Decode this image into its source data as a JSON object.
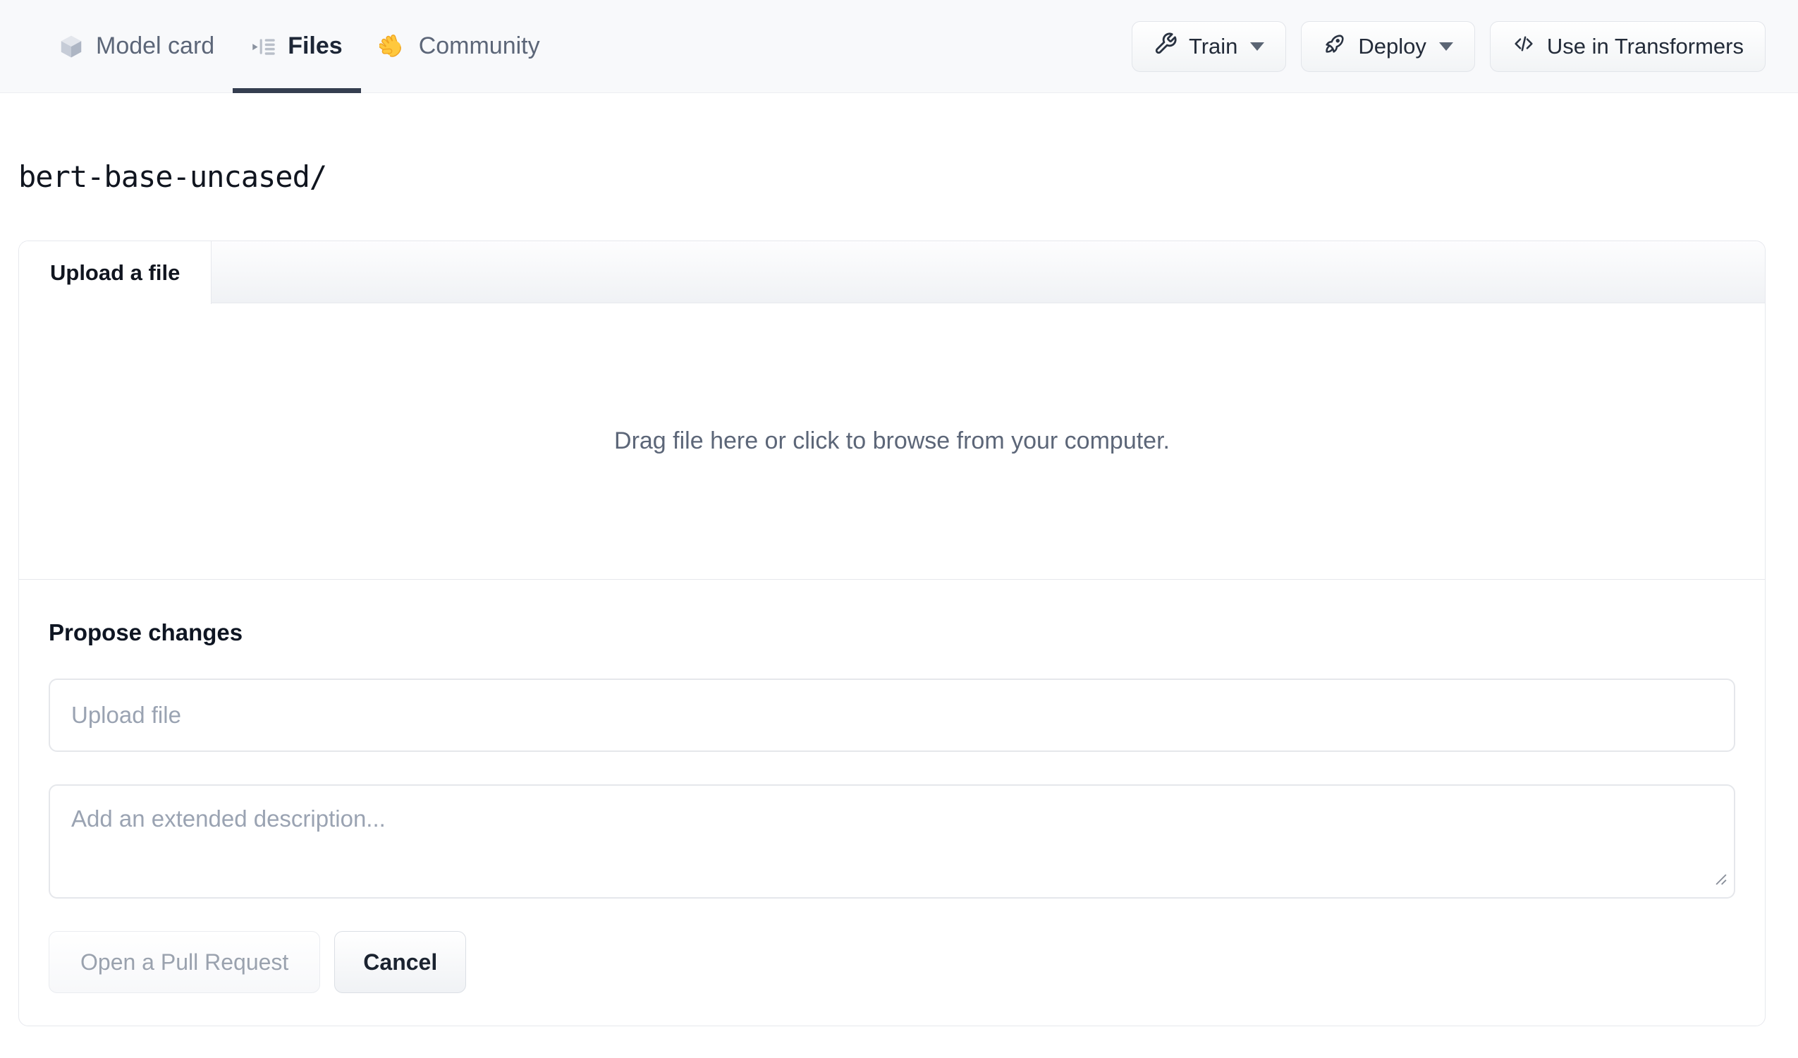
{
  "header": {
    "tabs": [
      {
        "label": "Model card",
        "icon": "cube-icon",
        "active": false
      },
      {
        "label": "Files",
        "icon": "file-versions-icon",
        "active": true
      },
      {
        "label": "Community",
        "icon": "waving-hand-icon",
        "active": false
      }
    ],
    "actions": [
      {
        "label": "Train",
        "icon": "wrench-icon",
        "has_dropdown": true
      },
      {
        "label": "Deploy",
        "icon": "rocket-icon",
        "has_dropdown": true
      },
      {
        "label": "Use in Transformers",
        "icon": "code-icon",
        "has_dropdown": false
      }
    ]
  },
  "repo": {
    "path": "bert-base-uncased/"
  },
  "upload_card": {
    "tab_label": "Upload a file",
    "dropzone_text": "Drag file here or click to browse from your computer.",
    "propose_heading": "Propose changes",
    "filename_placeholder": "Upload file",
    "description_placeholder": "Add an extended description...",
    "open_pr_label": "Open a Pull Request",
    "cancel_label": "Cancel"
  },
  "colors": {
    "active_underline": "#353e50",
    "header_bg": "#f8f9fb",
    "card_border": "#e6e8ed",
    "muted_text": "#5c6678",
    "placeholder_text": "#9aa3b2",
    "disabled_text": "#9aa2ae",
    "hand_yellow": "#ffc83d"
  }
}
